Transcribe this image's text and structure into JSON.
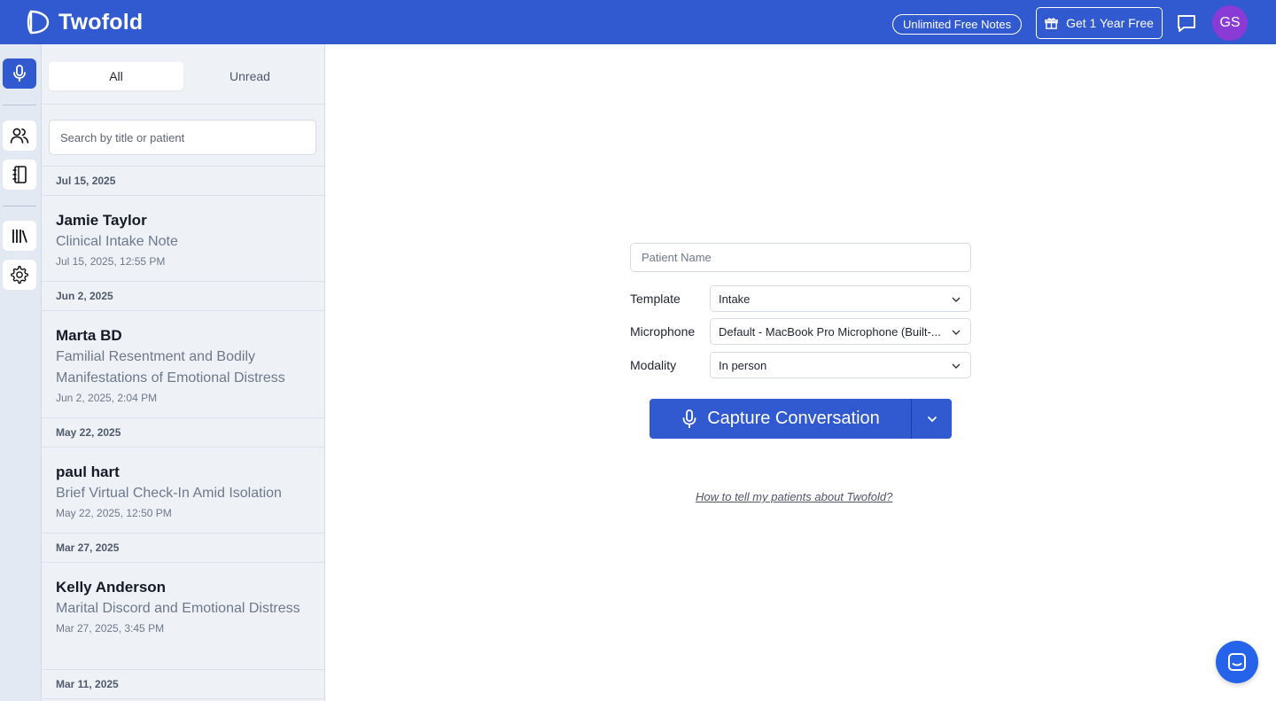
{
  "header": {
    "app_name": "Twofold",
    "promo_pill": "Unlimited Free Notes",
    "gift_button": "Get 1 Year Free",
    "avatar_initials": "GS",
    "colors": {
      "brand": "#3159d0",
      "avatar": "#8a3bd6"
    }
  },
  "rail": {
    "items": [
      {
        "icon": "microphone-icon",
        "active": true
      },
      {
        "icon": "users-icon",
        "active": false
      },
      {
        "icon": "notebook-icon",
        "active": false
      },
      {
        "icon": "library-icon",
        "active": false
      },
      {
        "icon": "gear-icon",
        "active": false
      }
    ]
  },
  "notes_panel": {
    "tabs": [
      {
        "label": "All",
        "active": true
      },
      {
        "label": "Unread",
        "active": false
      }
    ],
    "search_placeholder": "Search by title or patient",
    "groups": [
      {
        "date": "Jul 15, 2025",
        "notes": [
          {
            "patient": "Jamie Taylor",
            "title": "Clinical Intake Note",
            "timestamp": "Jul 15, 2025, 12:55 PM"
          }
        ]
      },
      {
        "date": "Jun 2, 2025",
        "notes": [
          {
            "patient": "Marta BD",
            "title": "Familial Resentment and Bodily Manifestations of Emotional Distress",
            "timestamp": "Jun 2, 2025, 2:04 PM"
          }
        ]
      },
      {
        "date": "May 22, 2025",
        "notes": [
          {
            "patient": "paul hart",
            "title": "Brief Virtual Check-In Amid Isolation",
            "timestamp": "May 22, 2025, 12:50 PM"
          }
        ]
      },
      {
        "date": "Mar 27, 2025",
        "notes": [
          {
            "patient": "Kelly Anderson",
            "title": "Marital Discord and Emotional Distress",
            "timestamp": "Mar 27, 2025, 3:45 PM"
          }
        ]
      },
      {
        "date": "Mar 11, 2025",
        "notes": []
      }
    ]
  },
  "capture_form": {
    "patient_placeholder": "Patient Name",
    "template_label": "Template",
    "template_value": "Intake",
    "microphone_label": "Microphone",
    "microphone_value": "Default - MacBook Pro Microphone (Built-...",
    "modality_label": "Modality",
    "modality_value": "In person",
    "capture_button": "Capture Conversation",
    "help_link": "How to tell my patients about Twofold?"
  }
}
